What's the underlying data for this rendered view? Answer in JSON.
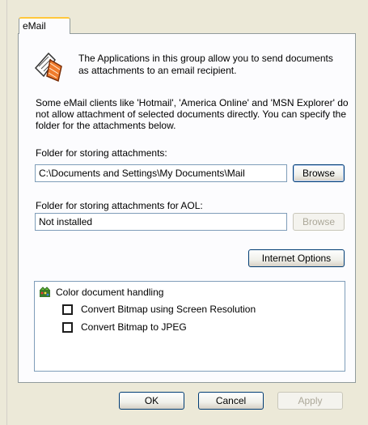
{
  "tab": {
    "label": "eMail"
  },
  "intro": {
    "text": "The Applications in this group allow you to send documents as attachments to an email recipient."
  },
  "note": {
    "text": "Some eMail clients like 'Hotmail', 'America Online' and 'MSN Explorer' do not allow attachment of selected documents directly. You can specify the folder for the attachments below."
  },
  "attachments": {
    "label": "Folder for storing attachments:",
    "value": "C:\\Documents and Settings\\My Documents\\Mail",
    "browse": "Browse"
  },
  "aol": {
    "label": "Folder for storing attachments for AOL:",
    "value": "Not installed",
    "browse": "Browse"
  },
  "internet_options": "Internet Options",
  "color_group": {
    "label": "Color document handling",
    "options": [
      {
        "label": "Convert Bitmap using Screen Resolution",
        "checked": false
      },
      {
        "label": "Convert Bitmap to JPEG",
        "checked": false
      }
    ]
  },
  "footer": {
    "ok": "OK",
    "cancel": "Cancel",
    "apply": "Apply"
  },
  "colors": {
    "accent_tab": "#ffc83c",
    "button_border": "#003c74",
    "field_border": "#7f9db9"
  },
  "icons": {
    "app": "email-applications-icon",
    "group": "color-document-icon"
  }
}
